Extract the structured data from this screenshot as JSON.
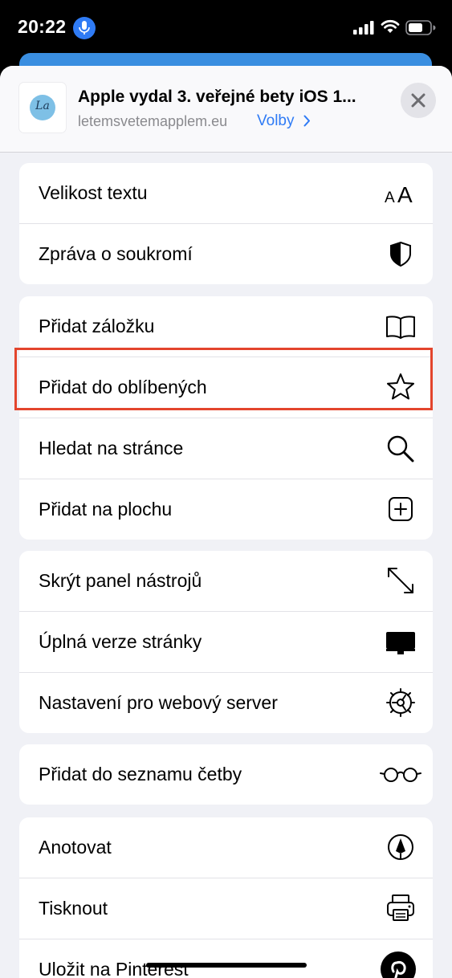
{
  "status_bar": {
    "time": "20:22",
    "icons": [
      "microphone-icon",
      "cellular-signal-icon",
      "wifi-icon",
      "battery-icon"
    ]
  },
  "header": {
    "title": "Apple vydal 3. veřejné bety iOS 1...",
    "domain": "letemsvetemapplem.eu",
    "options_label": "Volby",
    "logo_text": "La"
  },
  "groups": [
    {
      "items": [
        {
          "label": "Velikost textu",
          "icon": "text-size-icon"
        },
        {
          "label": "Zpráva o soukromí",
          "icon": "shield-icon"
        }
      ]
    },
    {
      "items": [
        {
          "label": "Přidat záložku",
          "icon": "book-icon"
        },
        {
          "label": "Přidat do oblíbených",
          "icon": "star-icon"
        },
        {
          "label": "Hledat na stránce",
          "icon": "search-icon",
          "highlighted": true
        },
        {
          "label": "Přidat na plochu",
          "icon": "plus-square-icon"
        }
      ]
    },
    {
      "items": [
        {
          "label": "Skrýt panel nástrojů",
          "icon": "expand-arrows-icon"
        },
        {
          "label": "Úplná verze stránky",
          "icon": "desktop-icon"
        },
        {
          "label": "Nastavení pro webový server",
          "icon": "gear-icon"
        }
      ]
    },
    {
      "items": [
        {
          "label": "Přidat do seznamu četby",
          "icon": "glasses-icon"
        }
      ]
    },
    {
      "items": [
        {
          "label": "Anotovat",
          "icon": "markup-pen-icon"
        },
        {
          "label": "Tisknout",
          "icon": "printer-icon"
        },
        {
          "label": "Uložit na Pinterest",
          "icon": "pinterest-icon"
        }
      ]
    }
  ],
  "colors": {
    "accent": "#2f7bf5",
    "highlight_border": "#e3452d",
    "sheet_background": "#f0f1f6"
  }
}
